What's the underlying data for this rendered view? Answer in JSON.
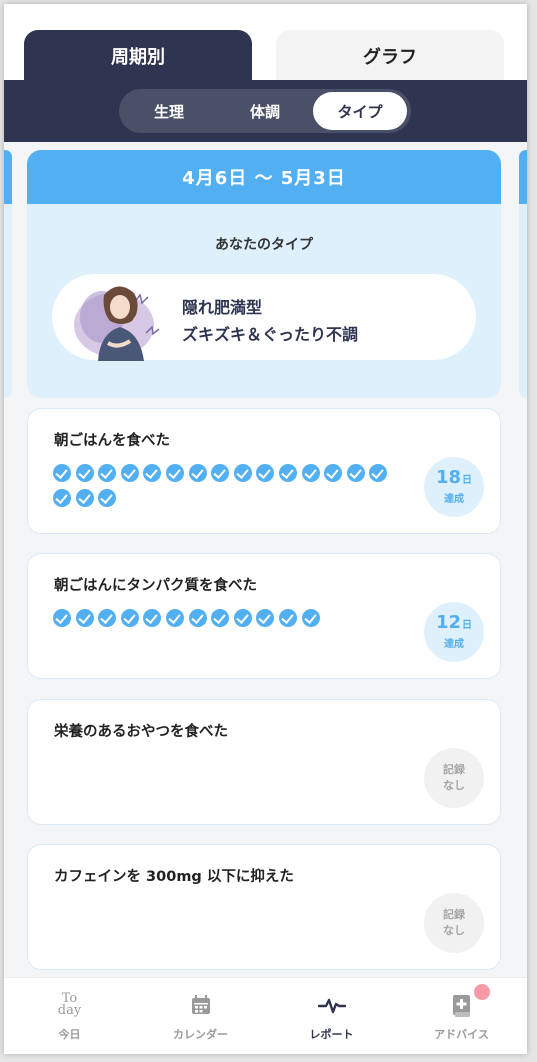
{
  "top_tabs": [
    {
      "label": "周期別",
      "active": true
    },
    {
      "label": "グラフ",
      "active": false
    }
  ],
  "segments": [
    {
      "label": "生理",
      "active": false
    },
    {
      "label": "体調",
      "active": false
    },
    {
      "label": "タイプ",
      "active": true
    }
  ],
  "type_card": {
    "period": "4月6日 〜 5月3日",
    "label": "あなたのタイプ",
    "type_line1": "隠れ肥満型",
    "type_line2": "ズキズキ＆ぐったり不調"
  },
  "habits": [
    {
      "title": "朝ごはんを食べた",
      "checks": 18,
      "badge_num": "18",
      "badge_unit": "日",
      "badge_sub": "達成",
      "status": "done"
    },
    {
      "title": "朝ごはんにタンパク質を食べた",
      "checks": 12,
      "badge_num": "12",
      "badge_unit": "日",
      "badge_sub": "達成",
      "status": "done"
    },
    {
      "title": "栄養のあるおやつを食べた",
      "checks": 0,
      "badge_line1": "記録",
      "badge_line2": "なし",
      "status": "none"
    },
    {
      "title": "カフェインを 300mg 以下に抑えた",
      "checks": 0,
      "badge_line1": "記録",
      "badge_line2": "なし",
      "status": "none"
    }
  ],
  "bottom_nav": [
    {
      "label": "今日",
      "icon": "today-icon",
      "icon_text_top": "To",
      "icon_text_bottom": "day",
      "active": false
    },
    {
      "label": "カレンダー",
      "icon": "calendar-icon",
      "active": false
    },
    {
      "label": "レポート",
      "icon": "pulse-icon",
      "active": true
    },
    {
      "label": "アドバイス",
      "icon": "advice-book-icon",
      "active": false,
      "has_notification": true
    }
  ],
  "colors": {
    "navy": "#2f3550",
    "accent_blue": "#52b0f2",
    "light_blue": "#dff0fd",
    "notification": "#f59aa6"
  }
}
